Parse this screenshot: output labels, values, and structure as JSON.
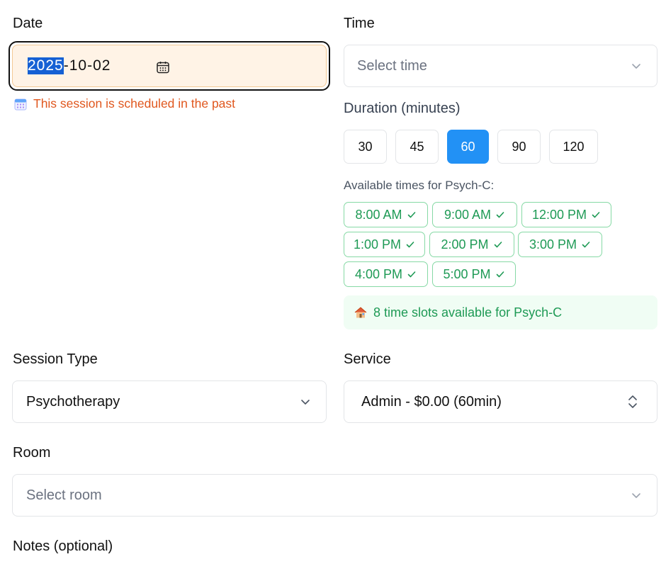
{
  "date": {
    "label": "Date",
    "year": "2025",
    "rest": "-10-02",
    "warning": "This session is scheduled in the past",
    "icon": "calendar-icon"
  },
  "time": {
    "label": "Time",
    "placeholder": "Select time"
  },
  "duration": {
    "label": "Duration (minutes)",
    "options": [
      "30",
      "45",
      "60",
      "90",
      "120"
    ],
    "selected": "60"
  },
  "availability": {
    "label": "Available times for Psych-C:",
    "slots": [
      "8:00 AM",
      "9:00 AM",
      "12:00 PM",
      "1:00 PM",
      "2:00 PM",
      "3:00 PM",
      "4:00 PM",
      "5:00 PM"
    ],
    "summary": "8 time slots available for Psych-C"
  },
  "session_type": {
    "label": "Session Type",
    "value": "Psychotherapy"
  },
  "service": {
    "label": "Service",
    "value": "Admin - $0.00 (60min)"
  },
  "room": {
    "label": "Room",
    "placeholder": "Select room"
  },
  "notes": {
    "label": "Notes (optional)"
  },
  "colors": {
    "accent": "#2291f5",
    "warning": "#e0571e",
    "success": "#1e9a55",
    "date_bg": "#fff3e6"
  }
}
